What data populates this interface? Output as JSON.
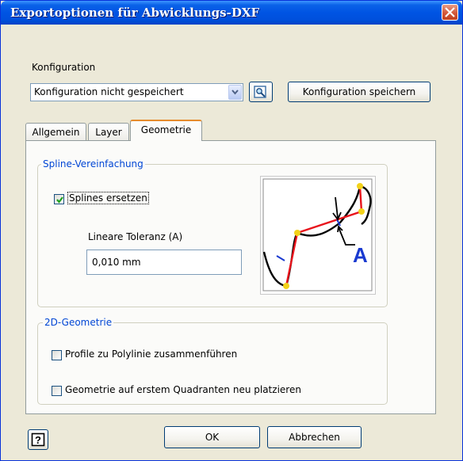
{
  "window": {
    "title": "Exportoptionen für Abwicklungs-DXF"
  },
  "config": {
    "label": "Konfiguration",
    "selected": "Konfiguration nicht gespeichert",
    "save_button": "Konfiguration speichern"
  },
  "tabs": [
    {
      "label": "Allgemein",
      "active": false
    },
    {
      "label": "Layer",
      "active": false
    },
    {
      "label": "Geometrie",
      "active": true
    }
  ],
  "spline": {
    "group_label": "Spline-Vereinfachung",
    "replace_label": "Splines ersetzen",
    "replace_checked": true,
    "tolerance_label": "Lineare Toleranz (A)",
    "tolerance_value": "0,010 mm",
    "preview_label": "A"
  },
  "geometry2d": {
    "group_label": "2D-Geometrie",
    "merge_label": "Profile zu Polylinie zusammenführen",
    "merge_checked": false,
    "reposition_label": "Geometrie auf erstem Quadranten neu platzieren",
    "reposition_checked": false
  },
  "footer": {
    "ok": "OK",
    "cancel": "Abbrechen"
  },
  "colors": {
    "title_blue": "#0054e3",
    "legend_blue": "#0046d5",
    "close_red": "#d4583a",
    "spline_red": "#e8141c",
    "node_yellow": "#f2d21a"
  }
}
